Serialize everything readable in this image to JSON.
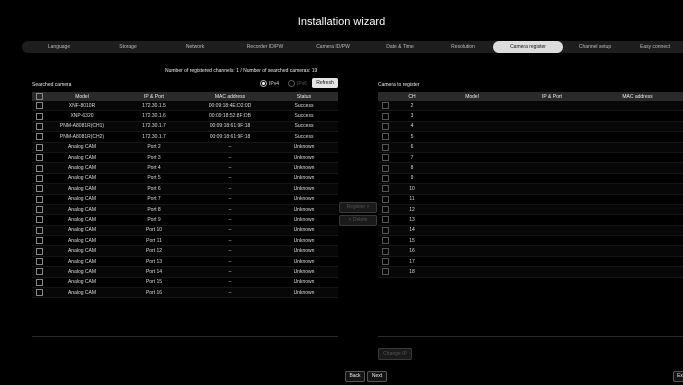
{
  "wizard": {
    "title": "Installation wizard",
    "steps": [
      "Language",
      "Storage",
      "Network",
      "Recorder ID/PW",
      "Camera ID/PW",
      "Date & Time",
      "Resolution",
      "Camera register",
      "Channel setup",
      "Easy connect"
    ],
    "active_step": "Camera register"
  },
  "summary": {
    "text": "Number of registered channels: 1 / Number of searched cameras: 19",
    "ipv4_label": "IPv4",
    "ipv6_label": "IPv6",
    "selected_ip": "IPv4",
    "refresh_label": "Refresh"
  },
  "searched": {
    "title": "Searched camera",
    "columns": [
      "Model",
      "IP & Port",
      "MAC address",
      "Status"
    ],
    "rows": [
      {
        "model": "XNF-8010R",
        "ip": "172.30.1.5",
        "mac": "00:09:18:4E:D2:0D",
        "status": "Success"
      },
      {
        "model": "XNP-6320",
        "ip": "172.30.1.6",
        "mac": "00:09:18:52:8F:DB",
        "status": "Success"
      },
      {
        "model": "PNM-A8081R(CH1)",
        "ip": "172.30.1.7",
        "mac": "00:09:18:61:9F:18",
        "status": "Success"
      },
      {
        "model": "PNM-A8081R(CH2)",
        "ip": "172.30.1.7",
        "mac": "00:09:18:61:9F:18",
        "status": "Success"
      },
      {
        "model": "Analog CAM",
        "ip": "Port 2",
        "mac": "–",
        "status": "Unknown"
      },
      {
        "model": "Analog CAM",
        "ip": "Port 3",
        "mac": "–",
        "status": "Unknown"
      },
      {
        "model": "Analog CAM",
        "ip": "Port 4",
        "mac": "–",
        "status": "Unknown"
      },
      {
        "model": "Analog CAM",
        "ip": "Port 5",
        "mac": "–",
        "status": "Unknown"
      },
      {
        "model": "Analog CAM",
        "ip": "Port 6",
        "mac": "–",
        "status": "Unknown"
      },
      {
        "model": "Analog CAM",
        "ip": "Port 7",
        "mac": "–",
        "status": "Unknown"
      },
      {
        "model": "Analog CAM",
        "ip": "Port 8",
        "mac": "–",
        "status": "Unknown"
      },
      {
        "model": "Analog CAM",
        "ip": "Port 9",
        "mac": "–",
        "status": "Unknown"
      },
      {
        "model": "Analog CAM",
        "ip": "Port 10",
        "mac": "–",
        "status": "Unknown"
      },
      {
        "model": "Analog CAM",
        "ip": "Port 11",
        "mac": "–",
        "status": "Unknown"
      },
      {
        "model": "Analog CAM",
        "ip": "Port 12",
        "mac": "–",
        "status": "Unknown"
      },
      {
        "model": "Analog CAM",
        "ip": "Port 13",
        "mac": "–",
        "status": "Unknown"
      },
      {
        "model": "Analog CAM",
        "ip": "Port 14",
        "mac": "–",
        "status": "Unknown"
      },
      {
        "model": "Analog CAM",
        "ip": "Port 15",
        "mac": "–",
        "status": "Unknown"
      },
      {
        "model": "Analog CAM",
        "ip": "Port 16",
        "mac": "–",
        "status": "Unknown"
      }
    ]
  },
  "actions": {
    "register_label": "Register >",
    "delete_label": "< Delete",
    "change_ip_label": "Change IP"
  },
  "to_register": {
    "title": "Camera to register",
    "columns": [
      "CH",
      "Model",
      "IP & Port",
      "MAC address"
    ],
    "channels": [
      "2",
      "3",
      "4",
      "5",
      "6",
      "7",
      "8",
      "9",
      "10",
      "11",
      "12",
      "13",
      "14",
      "15",
      "16",
      "17",
      "18"
    ]
  },
  "nav": {
    "back_label": "Back",
    "next_label": "Next",
    "exit_label": "Ex"
  }
}
